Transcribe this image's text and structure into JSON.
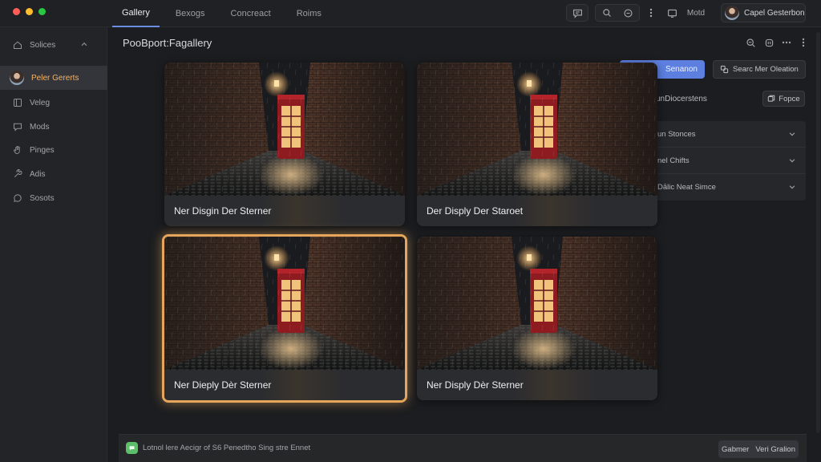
{
  "window": {
    "traffic_lights": [
      "#ff5f57",
      "#febc2e",
      "#28c840"
    ]
  },
  "topbar": {
    "tabs": [
      {
        "label": "Gallery",
        "active": true
      },
      {
        "label": "Bexogs",
        "active": false
      },
      {
        "label": "Concreact",
        "active": false
      },
      {
        "label": "Roims",
        "active": false
      }
    ],
    "mode_label": "Motd",
    "user_name": "Capel Gesterbon",
    "accent_color": "#6a8fe0"
  },
  "sidebar": {
    "section": {
      "label": "Solices",
      "icon": "home-icon"
    },
    "user": {
      "label": "Peler Gererts",
      "active_color": "#f0b36b"
    },
    "items": [
      {
        "label": "Veleg",
        "icon": "layout-icon"
      },
      {
        "label": "Mods",
        "icon": "message-icon"
      },
      {
        "label": "Pinges",
        "icon": "hand-icon"
      },
      {
        "label": "Adis",
        "icon": "tool-icon"
      },
      {
        "label": "Sosots",
        "icon": "chat-icon"
      }
    ]
  },
  "main": {
    "title": "PooBport:Fagallery",
    "cards": [
      {
        "label": "Ner Disgin Der Sterner",
        "selected": false
      },
      {
        "label": "Der Disply Der Staroet",
        "selected": false
      },
      {
        "label": "Ner Dieply Dèr Sterner",
        "selected": true
      },
      {
        "label": "Ner Disply Dèr Sterner",
        "selected": false
      }
    ],
    "selection_color": "#e5a55a"
  },
  "right_panel": {
    "primary_button": "Senanon",
    "secondary_button": "Searc Mer Oleation",
    "row_label": "unDiocerstens",
    "row_button": "Fopce",
    "accordions": [
      {
        "label": "un Stonces"
      },
      {
        "label": "nel Chifts"
      },
      {
        "label": "Dālic Neat Simce"
      }
    ],
    "primary_color": "#5d7fe0"
  },
  "statusbar": {
    "text": "Lotnol lere Aecigr of S6 Penedtho Sing stre Ennet",
    "button_left": "Gabmer",
    "button_right": "Veri Gralion",
    "status_color": "#5cbf6a"
  }
}
